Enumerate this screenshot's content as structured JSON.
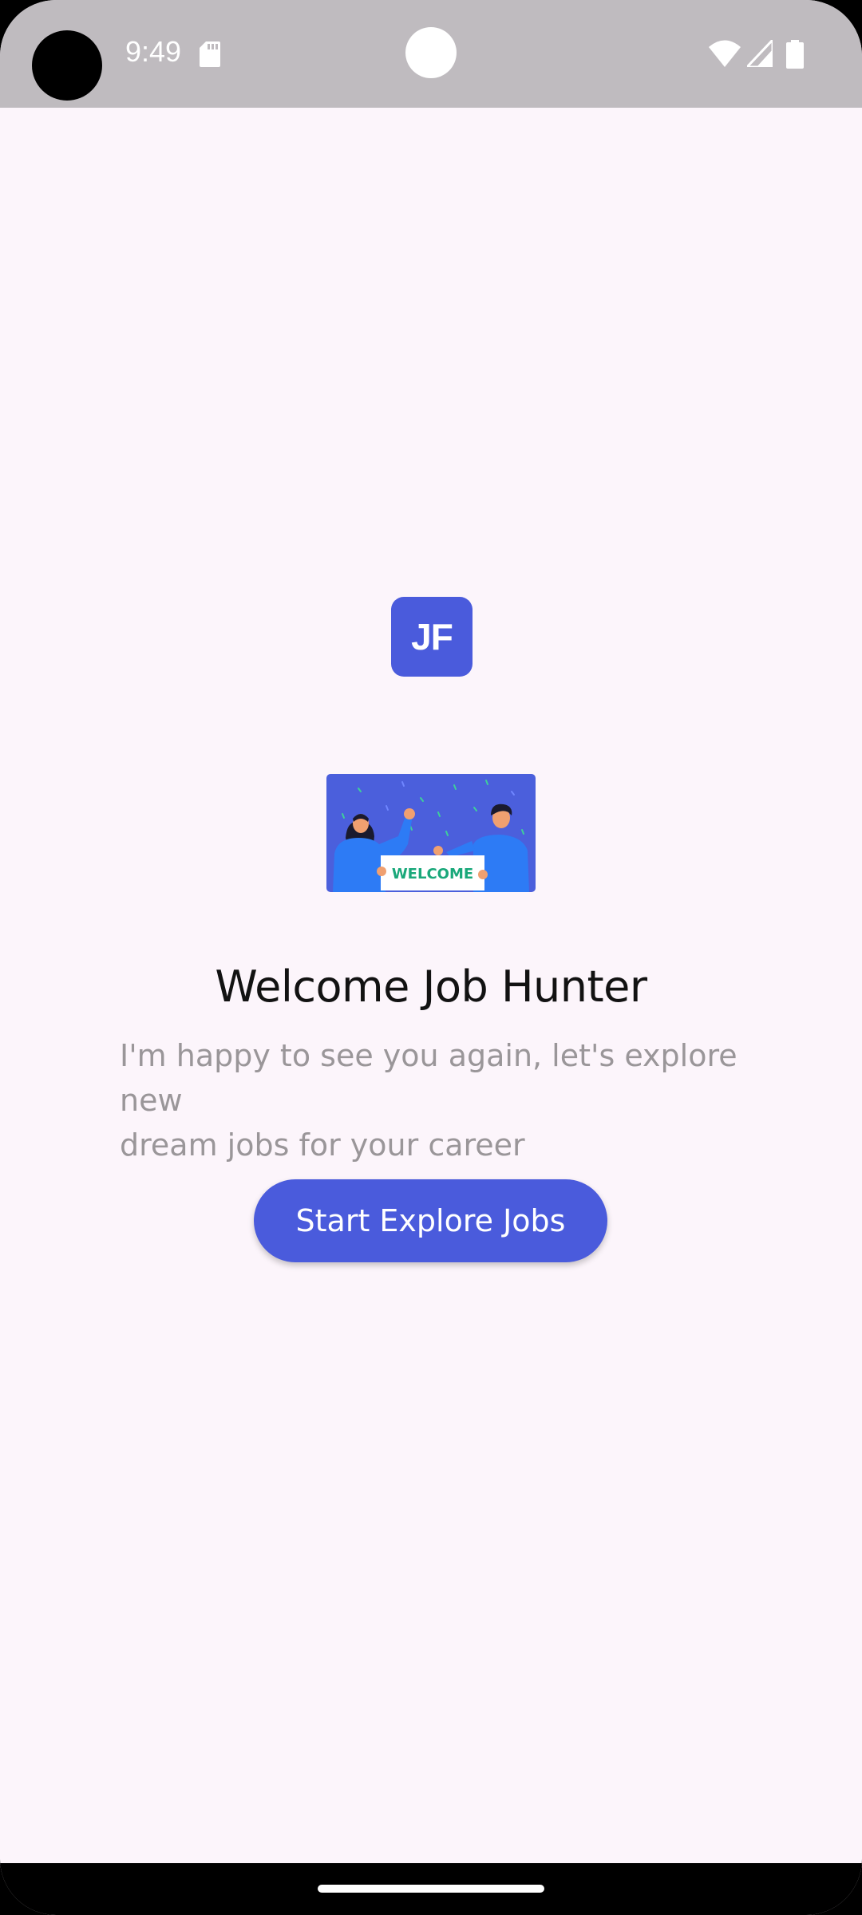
{
  "status_bar": {
    "time": "9:49",
    "icons": [
      "sd-card-icon",
      "wifi-icon",
      "signal-icon",
      "battery-icon"
    ]
  },
  "logo": {
    "text": "JF",
    "color": "#4a5bdc"
  },
  "illustration": {
    "banner_text": "WELCOME",
    "banner_color": "#19a87a"
  },
  "welcome": {
    "title": "Welcome Job Hunter",
    "subtitle": "I'm happy to see you again, let's explore new\n dream jobs for your career"
  },
  "cta": {
    "label": "Start Explore Jobs",
    "color": "#4a5bdc"
  }
}
